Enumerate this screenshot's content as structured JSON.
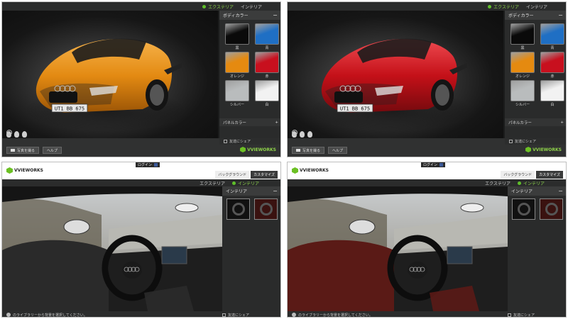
{
  "exterior": {
    "tabs": [
      {
        "label": "エクステリア",
        "active": true
      },
      {
        "label": "インテリア",
        "active": false
      }
    ],
    "panel_title": "ボディカラー",
    "colors": [
      {
        "label": "黒",
        "hex": "#0a0a0a"
      },
      {
        "label": "青",
        "hex": "#1f6fc4"
      },
      {
        "label": "オレンジ",
        "hex": "#e58a10"
      },
      {
        "label": "赤",
        "hex": "#c8101e"
      },
      {
        "label": "シルバー",
        "hex": "#b9bcbd"
      },
      {
        "label": "白",
        "hex": "#f2f2f2"
      }
    ],
    "sub_panel": "パネルカラー",
    "share": "友達にシェア",
    "photo_button": "写真を撮る",
    "help_button": "ヘルプ",
    "plate": "UT1 BB 675",
    "views": [
      {
        "car_color": "#e38a12",
        "car_shade": "#9c5606",
        "car_light": "#f6b24a"
      },
      {
        "car_color": "#c41018",
        "car_shade": "#760a0e",
        "car_light": "#ee4a50"
      }
    ]
  },
  "logo": {
    "main": "VVIEWORKS"
  },
  "interior": {
    "login": "ログイン",
    "tabs": [
      {
        "label": "バックグラウンド",
        "active": false
      },
      {
        "label": "カスタマイズ",
        "active": true
      }
    ],
    "subtabs": [
      {
        "label": "エクステリア",
        "active": false
      },
      {
        "label": "インテリア",
        "active": true
      }
    ],
    "panel_title": "インテリア",
    "share": "友達にシェア",
    "hint": "のライブラリーから背景を選択してください。",
    "views": [
      {
        "leather": "#2a2a2a",
        "leather_light": "#4a4a4a"
      },
      {
        "leather": "#5a1a16",
        "leather_light": "#8a2e28"
      }
    ]
  }
}
